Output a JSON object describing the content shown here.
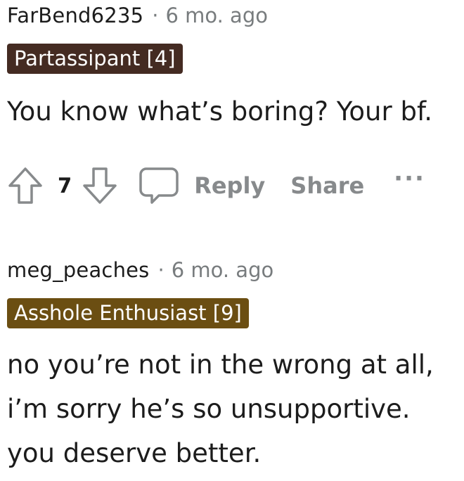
{
  "comments": [
    {
      "username": "FarBend6235",
      "separator": "·",
      "time": "6 mo. ago",
      "flair": "Partassipant [4]",
      "flair_color": "#442b22",
      "body_lines": [
        "You know what’s boring? Your bf."
      ],
      "score": "7",
      "actions": {
        "reply": "Reply",
        "share": "Share",
        "more": "···"
      }
    },
    {
      "username": "meg_peaches",
      "separator": "·",
      "time": "6 mo. ago",
      "flair": "Asshole Enthusiast [9]",
      "flair_color": "#6b4e12",
      "body_lines": [
        "no you’re not in the wrong at all,",
        "i’m sorry he’s so unsupportive.",
        "you deserve better."
      ]
    }
  ],
  "icons": {
    "upvote": "arrow-up-outline",
    "downvote": "arrow-down-outline",
    "comment": "speech-bubble-outline"
  },
  "colors": {
    "text": "#1c1c1c",
    "muted": "#787c7e",
    "action": "#878a8c"
  }
}
